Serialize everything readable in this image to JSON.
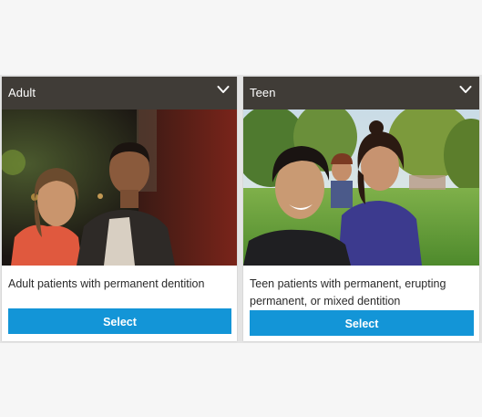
{
  "cards": [
    {
      "title": "Adult",
      "description": "Adult patients with permanent dentition",
      "button_label": "Select",
      "toggle_icon": "chevron-down-icon",
      "photo": "adult-couple-photo"
    },
    {
      "title": "Teen",
      "description": "Teen patients with permanent, erupting permanent, or mixed dentition",
      "button_label": "Select",
      "toggle_icon": "chevron-down-icon",
      "photo": "teen-friends-photo"
    }
  ],
  "colors": {
    "header_bg": "#403c37",
    "button_bg": "#1395d7",
    "page_bg": "#f6f6f6"
  }
}
